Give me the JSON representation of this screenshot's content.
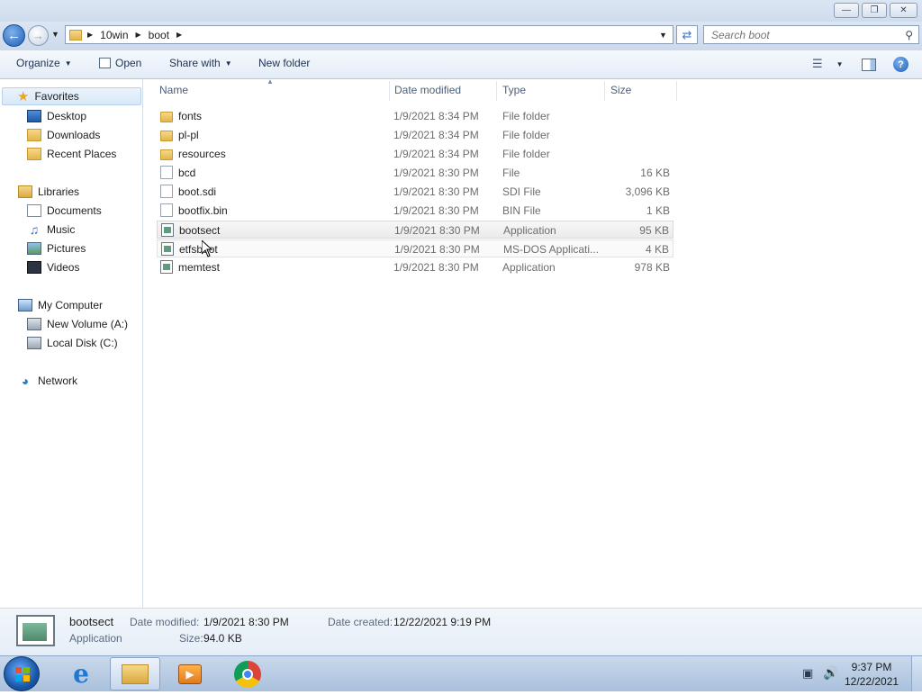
{
  "window": {
    "caption_buttons": {
      "minimize": "—",
      "restore": "❐",
      "close": "✕"
    }
  },
  "address": {
    "segments": [
      "10win",
      "boot"
    ],
    "search_placeholder": "Search boot"
  },
  "toolbar": {
    "organize": "Organize",
    "open": "Open",
    "share_with": "Share with",
    "new_folder": "New folder"
  },
  "nav": {
    "favorites": "Favorites",
    "favorites_items": [
      "Desktop",
      "Downloads",
      "Recent Places"
    ],
    "libraries": "Libraries",
    "libraries_items": [
      "Documents",
      "Music",
      "Pictures",
      "Videos"
    ],
    "computer": "My Computer",
    "computer_items": [
      "New Volume (A:)",
      "Local Disk (C:)"
    ],
    "network": "Network"
  },
  "columns": {
    "name": "Name",
    "date_modified": "Date modified",
    "type": "Type",
    "size": "Size"
  },
  "files": [
    {
      "name": "fonts",
      "date": "1/9/2021 8:34 PM",
      "type": "File folder",
      "size": "",
      "icon": "folder-icon"
    },
    {
      "name": "pl-pl",
      "date": "1/9/2021 8:34 PM",
      "type": "File folder",
      "size": "",
      "icon": "folder-icon"
    },
    {
      "name": "resources",
      "date": "1/9/2021 8:34 PM",
      "type": "File folder",
      "size": "",
      "icon": "folder-icon"
    },
    {
      "name": "bcd",
      "date": "1/9/2021 8:30 PM",
      "type": "File",
      "size": "16 KB",
      "icon": "file-icon"
    },
    {
      "name": "boot.sdi",
      "date": "1/9/2021 8:30 PM",
      "type": "SDI File",
      "size": "3,096 KB",
      "icon": "file-icon"
    },
    {
      "name": "bootfix.bin",
      "date": "1/9/2021 8:30 PM",
      "type": "BIN File",
      "size": "1 KB",
      "icon": "file-icon"
    },
    {
      "name": "bootsect",
      "date": "1/9/2021 8:30 PM",
      "type": "Application",
      "size": "95 KB",
      "icon": "application-icon"
    },
    {
      "name": "etfsboot",
      "date": "1/9/2021 8:30 PM",
      "type": "MS-DOS Applicati...",
      "size": "4 KB",
      "icon": "application-icon"
    },
    {
      "name": "memtest",
      "date": "1/9/2021 8:30 PM",
      "type": "Application",
      "size": "978 KB",
      "icon": "application-icon"
    }
  ],
  "details": {
    "name": "bootsect",
    "type": "Application",
    "date_modified_label": "Date modified:",
    "date_modified": "1/9/2021 8:30 PM",
    "date_created_label": "Date created:",
    "date_created": "12/22/2021 9:19 PM",
    "size_label": "Size:",
    "size": "94.0 KB"
  },
  "taskbar": {
    "time": "9:37 PM",
    "date": "12/22/2021"
  }
}
